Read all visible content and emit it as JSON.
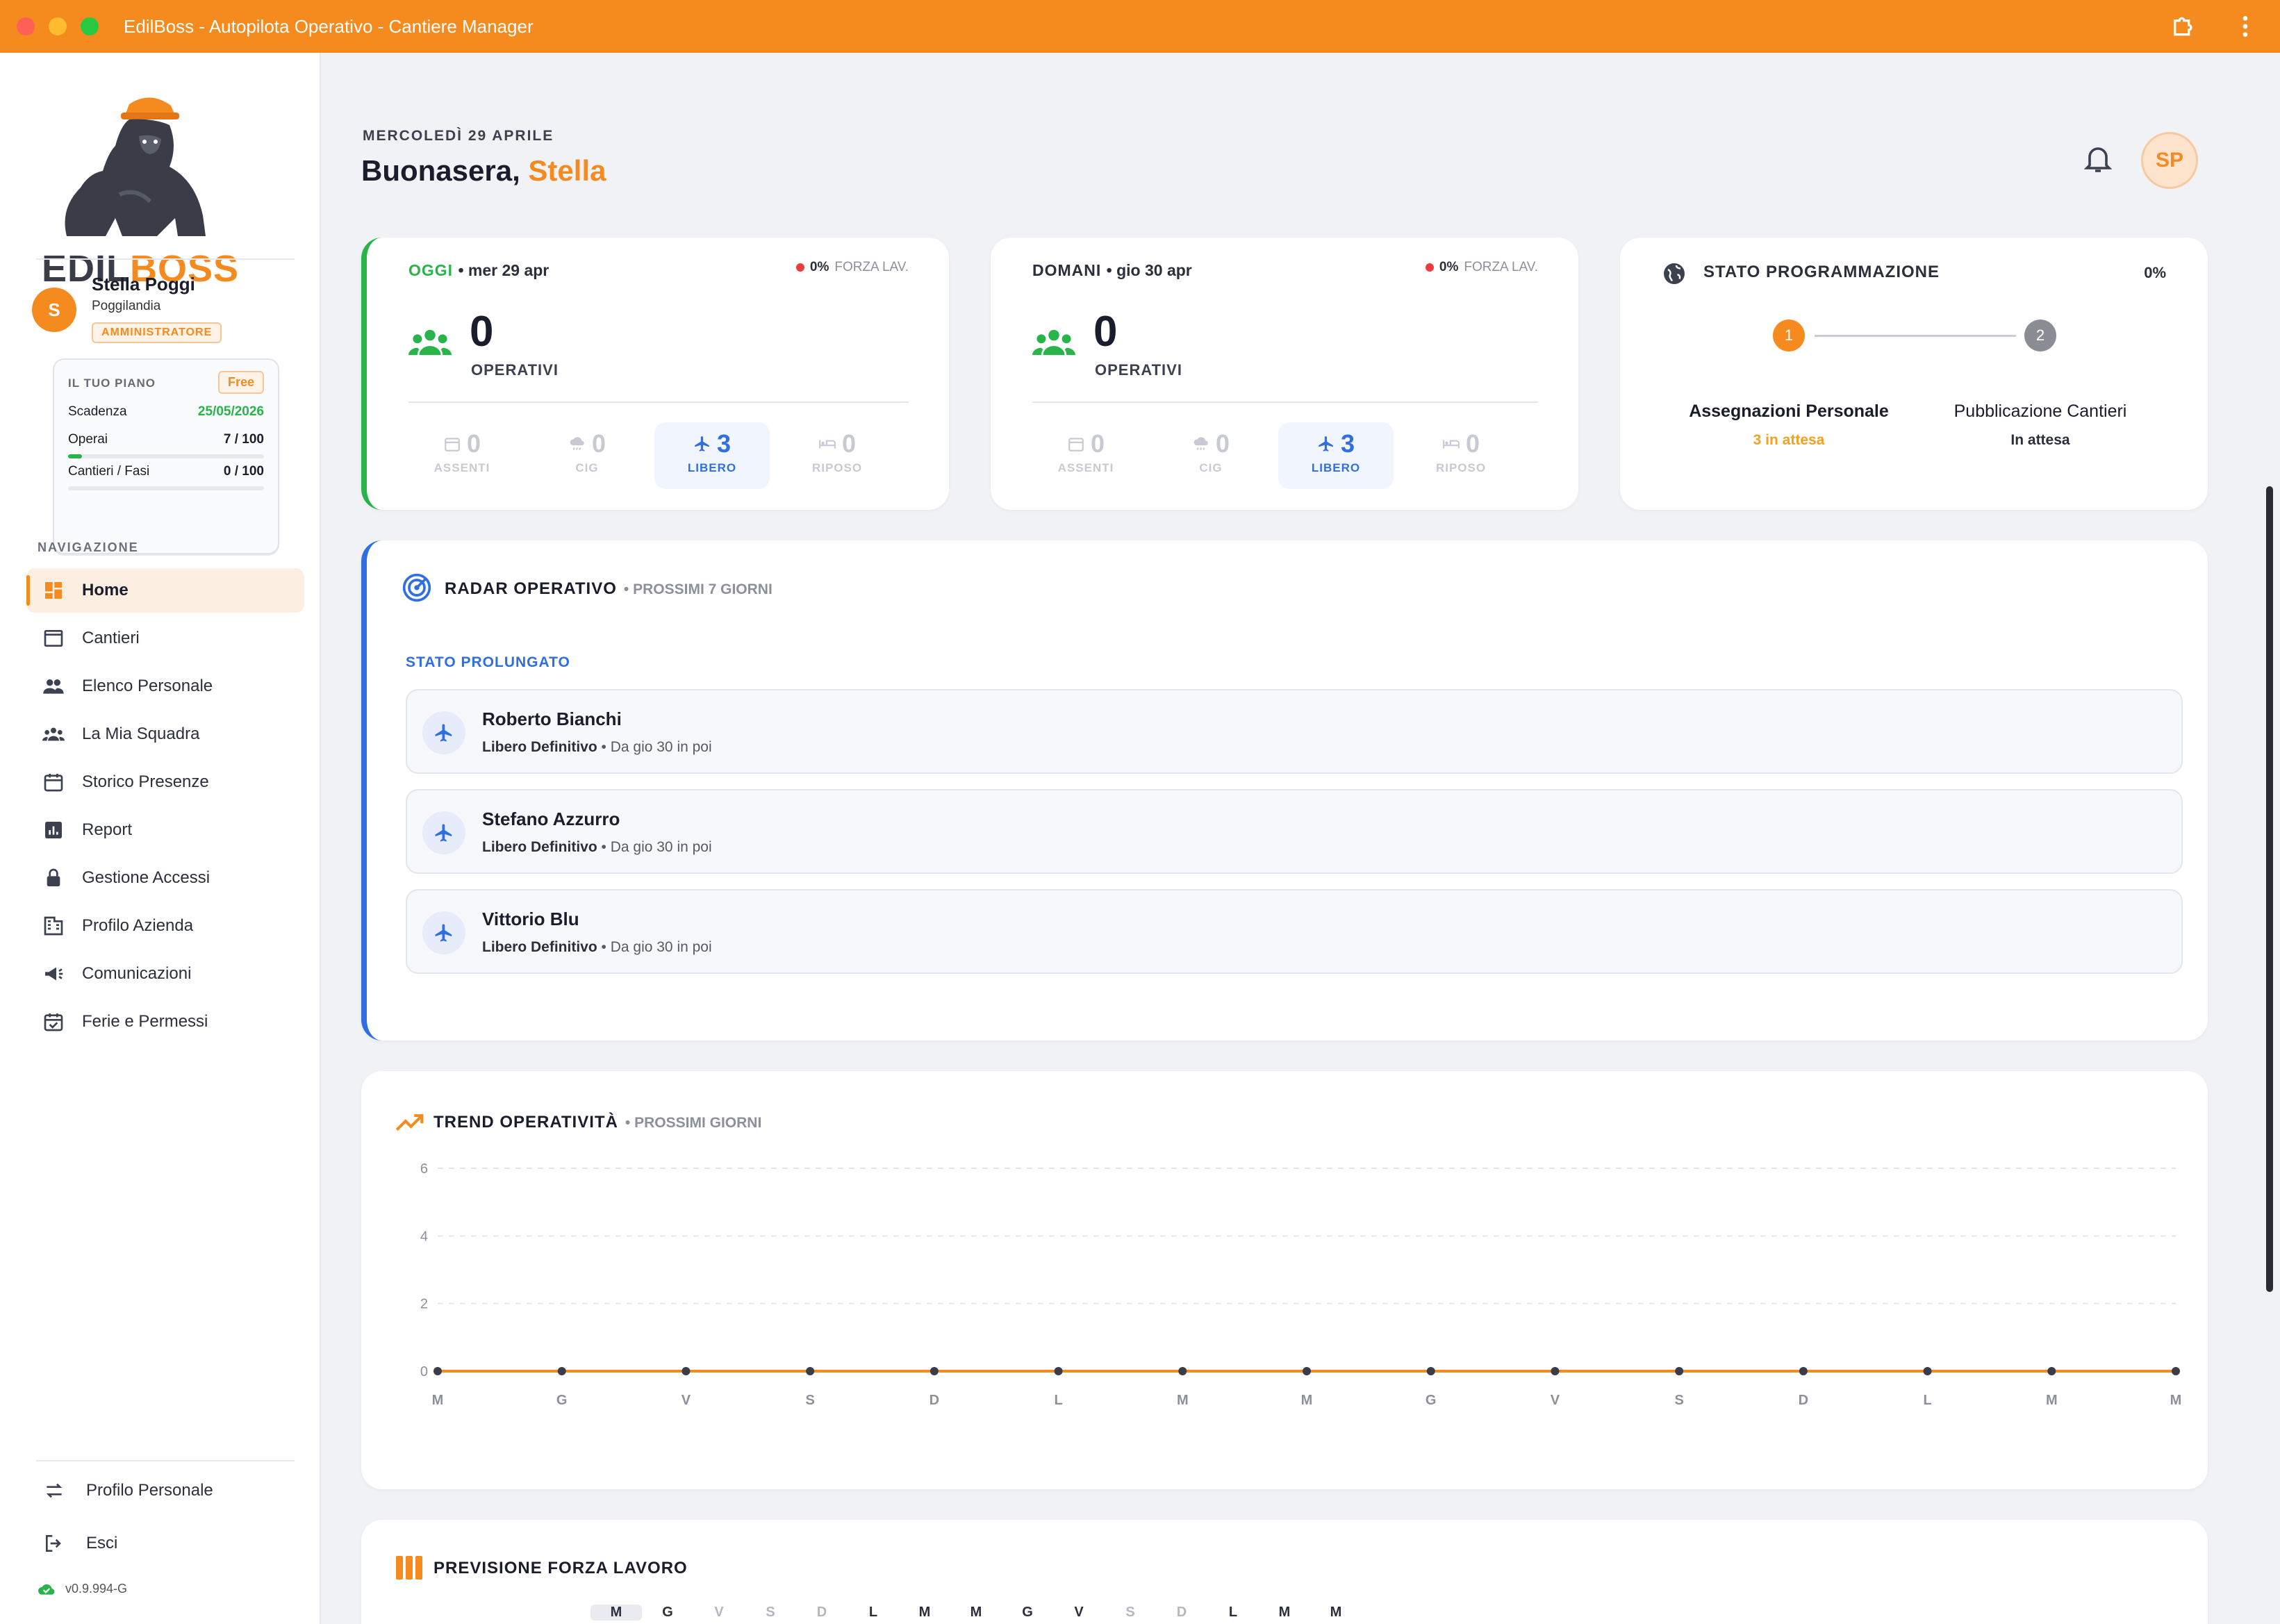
{
  "window": {
    "title": "EdilBoss - Autopilota Operativo - Cantiere Manager"
  },
  "brand": {
    "part1": "EDIL",
    "part2": "BOSS"
  },
  "user": {
    "initial": "S",
    "name": "Stella Poggi",
    "company": "Poggilandia",
    "role": "AMMINISTRATORE"
  },
  "plan": {
    "title": "IL TUO PIANO",
    "badge": "Free",
    "rows": [
      {
        "label": "Scadenza",
        "value": "25/05/2026"
      },
      {
        "label": "Operai",
        "value": "7 / 100",
        "progress": 0.07
      },
      {
        "label": "Cantieri / Fasi",
        "value": "0 / 100",
        "progress": 0
      }
    ]
  },
  "nav": {
    "title": "NAVIGAZIONE",
    "items": [
      {
        "label": "Home",
        "icon": "dashboard-icon"
      },
      {
        "label": "Cantieri",
        "icon": "window-icon"
      },
      {
        "label": "Elenco Personale",
        "icon": "people-icon"
      },
      {
        "label": "La Mia Squadra",
        "icon": "team-icon"
      },
      {
        "label": "Storico Presenze",
        "icon": "calendar-icon"
      },
      {
        "label": "Report",
        "icon": "bar-chart-icon"
      },
      {
        "label": "Gestione Accessi",
        "icon": "lock-icon"
      },
      {
        "label": "Profilo Azienda",
        "icon": "building-icon"
      },
      {
        "label": "Comunicazioni",
        "icon": "megaphone-icon"
      },
      {
        "label": "Ferie e Permessi",
        "icon": "calendar-check-icon"
      }
    ],
    "bottom": [
      {
        "label": "Profilo Personale",
        "icon": "swap-icon"
      },
      {
        "label": "Esci",
        "icon": "logout-icon"
      }
    ]
  },
  "version": "v0.9.994-G",
  "header": {
    "date": "MERCOLEDÌ 29 APRILE",
    "greeting": "Buonasera,",
    "name": "Stella",
    "avatar": "SP"
  },
  "today": {
    "label": "OGGI",
    "date": "• mer 29 apr",
    "forza_pct": "0%",
    "forza_label": "FORZA LAV.",
    "count": "0",
    "count_label": "OPERATIVI",
    "stats": [
      {
        "value": "0",
        "label": "ASSENTI"
      },
      {
        "value": "0",
        "label": "CIG"
      },
      {
        "value": "3",
        "label": "LIBERO"
      },
      {
        "value": "0",
        "label": "RIPOSO"
      }
    ]
  },
  "tomorrow": {
    "label": "DOMANI",
    "date": "• gio 30 apr",
    "forza_pct": "0%",
    "forza_label": "FORZA LAV.",
    "count": "0",
    "count_label": "OPERATIVI",
    "stats": [
      {
        "value": "0",
        "label": "ASSENTI"
      },
      {
        "value": "0",
        "label": "CIG"
      },
      {
        "value": "3",
        "label": "LIBERO"
      },
      {
        "value": "0",
        "label": "RIPOSO"
      }
    ]
  },
  "programmazione": {
    "title": "STATO PROGRAMMAZIONE",
    "pct": "0%",
    "steps": [
      {
        "num": "1",
        "label": "Assegnazioni Personale",
        "status": "3 in attesa",
        "color": "#f58a1f"
      },
      {
        "num": "2",
        "label": "Pubblicazione Cantieri",
        "status": "In attesa",
        "color": "#2b2f3b"
      }
    ]
  },
  "radar": {
    "title": "RADAR OPERATIVO",
    "subtitle": "• PROSSIMI 7 GIORNI",
    "section": "STATO PROLUNGATO",
    "items": [
      {
        "name": "Roberto Bianchi",
        "status": "Libero Definitivo",
        "when": "• Da gio 30 in poi"
      },
      {
        "name": "Stefano Azzurro",
        "status": "Libero Definitivo",
        "when": "• Da gio 30 in poi"
      },
      {
        "name": "Vittorio Blu",
        "status": "Libero Definitivo",
        "when": "• Da gio 30 in poi"
      }
    ]
  },
  "trend": {
    "title": "TREND OPERATIVITÀ",
    "subtitle": "• PROSSIMI GIORNI"
  },
  "chart_data": {
    "type": "line",
    "title": "TREND OPERATIVITÀ",
    "x": [
      "M",
      "G",
      "V",
      "S",
      "D",
      "L",
      "M",
      "M",
      "G",
      "V",
      "S",
      "D",
      "L",
      "M",
      "M"
    ],
    "series": [
      {
        "values": [
          0,
          0,
          0,
          0,
          0,
          0,
          0,
          0,
          0,
          0,
          0,
          0,
          0,
          0,
          0
        ],
        "color": "#f58a1f"
      }
    ],
    "yticks": [
      0,
      2,
      4,
      6
    ],
    "ylim": [
      0,
      6
    ],
    "grid": true
  },
  "forza": {
    "title": "PREVISIONE FORZA LAVORO",
    "days": [
      "M",
      "G",
      "V",
      "S",
      "D",
      "L",
      "M",
      "M",
      "G",
      "V",
      "S",
      "D",
      "L",
      "M",
      "M"
    ]
  }
}
